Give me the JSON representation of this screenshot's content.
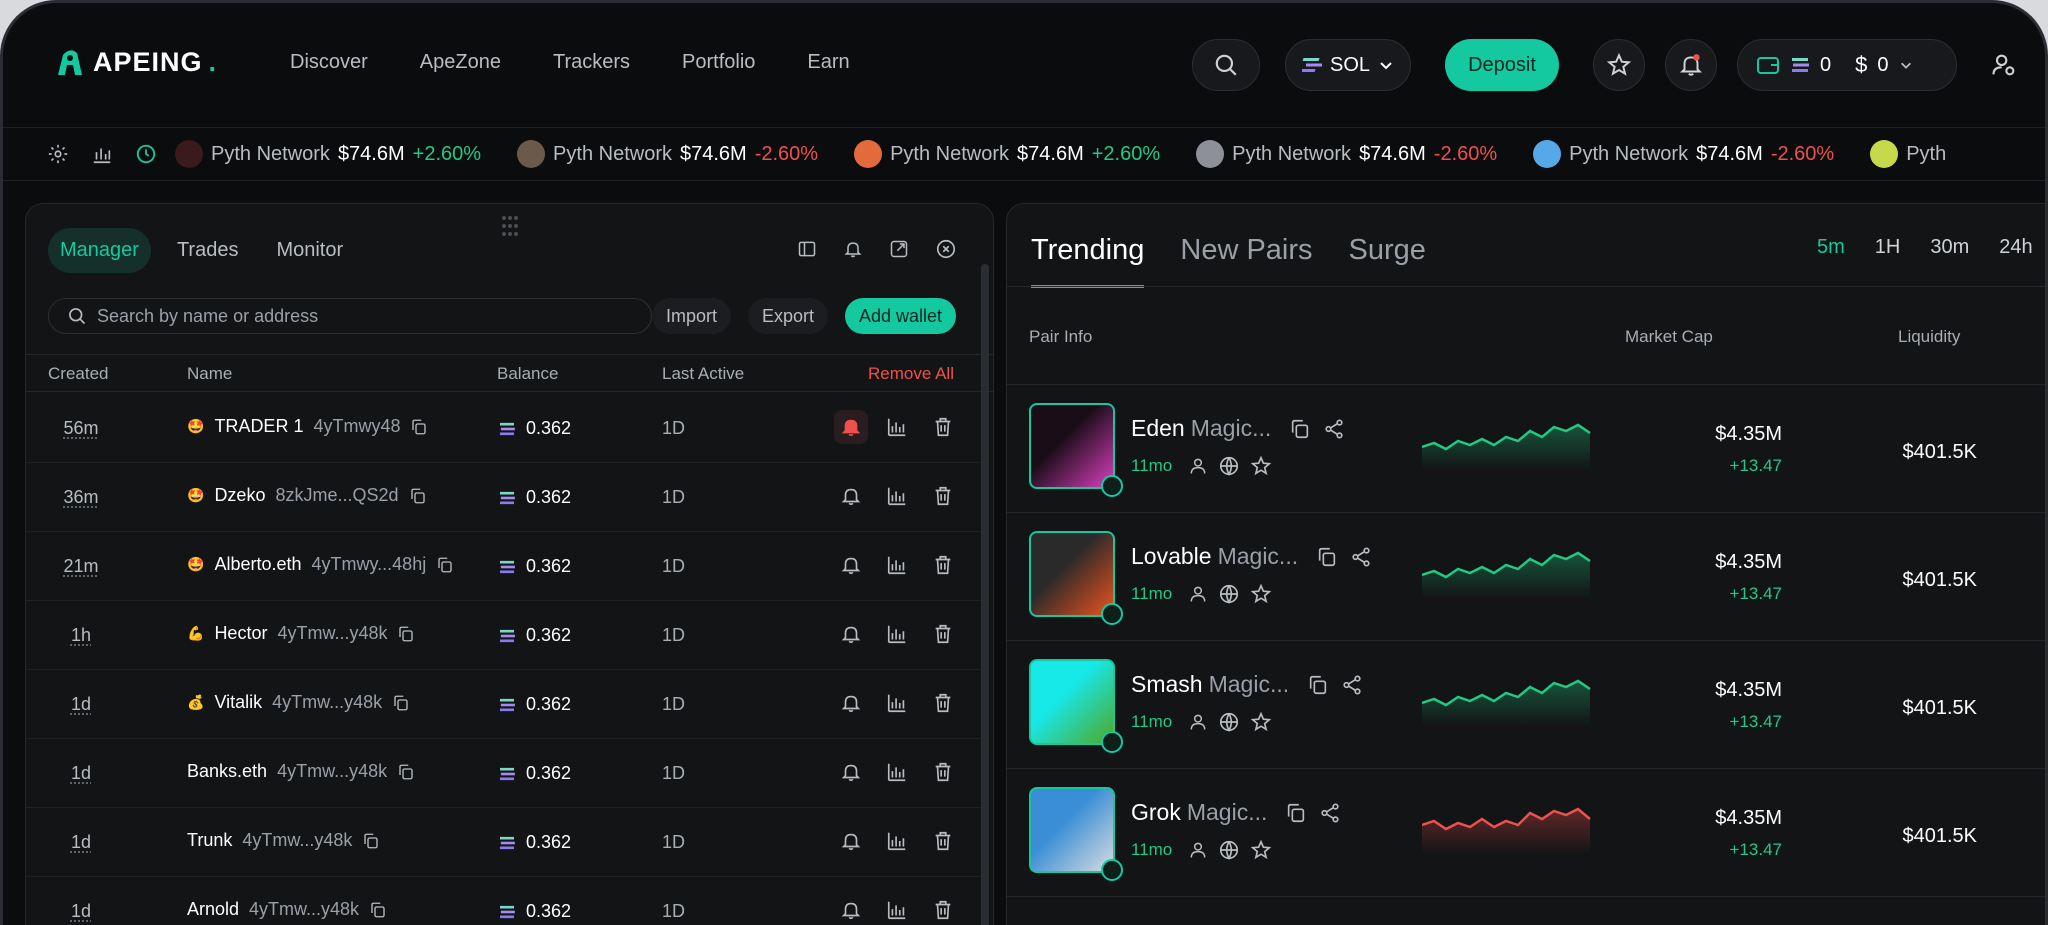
{
  "brand": {
    "name": "APEING",
    "dot": "."
  },
  "nav": [
    "Discover",
    "ApeZone",
    "Trackers",
    "Portfolio",
    "Earn"
  ],
  "header": {
    "chain": "SOL",
    "deposit": "Deposit",
    "sol_balance": "0",
    "usd_balance": "0"
  },
  "ticker": [
    {
      "name": "Pyth Network",
      "value": "$74.6M",
      "change": "+2.60%",
      "dir": "up",
      "color": "#3a1a1a"
    },
    {
      "name": "Pyth Network",
      "value": "$74.6M",
      "change": "-2.60%",
      "dir": "down",
      "color": "#6b5a4a"
    },
    {
      "name": "Pyth Network",
      "value": "$74.6M",
      "change": "+2.60%",
      "dir": "up",
      "color": "#e36a3a"
    },
    {
      "name": "Pyth Network",
      "value": "$74.6M",
      "change": "-2.60%",
      "dir": "down",
      "color": "#8d9096"
    },
    {
      "name": "Pyth Network",
      "value": "$74.6M",
      "change": "-2.60%",
      "dir": "down",
      "color": "#57a8e8"
    },
    {
      "name": "Pyth",
      "value": "",
      "change": "",
      "dir": "up",
      "color": "#c6d94a"
    }
  ],
  "manager": {
    "tabs": [
      "Manager",
      "Trades",
      "Monitor"
    ],
    "search_placeholder": "Search by name or address",
    "import": "Import",
    "export": "Export",
    "add_wallet": "Add wallet",
    "columns": {
      "created": "Created",
      "name": "Name",
      "balance": "Balance",
      "last_active": "Last Active",
      "remove_all": "Remove All"
    },
    "rows": [
      {
        "created": "56m",
        "emoji": "🤩",
        "name": "TRADER 1",
        "addr": "4yTmwy48",
        "balance": "0.362",
        "active": "1D",
        "bell": true
      },
      {
        "created": "36m",
        "emoji": "🤩",
        "name": "Dzeko",
        "addr": "8zkJme...QS2d",
        "balance": "0.362",
        "active": "1D",
        "bell": false
      },
      {
        "created": "21m",
        "emoji": "🤩",
        "name": "Alberto.eth",
        "addr": "4yTmwy...48hj",
        "balance": "0.362",
        "active": "1D",
        "bell": false
      },
      {
        "created": "1h",
        "emoji": "💪",
        "name": "Hector",
        "addr": "4yTmw...y48k",
        "balance": "0.362",
        "active": "1D",
        "bell": false
      },
      {
        "created": "1d",
        "emoji": "💰",
        "name": "Vitalik",
        "addr": "4yTmw...y48k",
        "balance": "0.362",
        "active": "1D",
        "bell": false
      },
      {
        "created": "1d",
        "emoji": "",
        "name": "Banks.eth",
        "addr": "4yTmw...y48k",
        "balance": "0.362",
        "active": "1D",
        "bell": false
      },
      {
        "created": "1d",
        "emoji": "",
        "name": "Trunk",
        "addr": "4yTmw...y48k",
        "balance": "0.362",
        "active": "1D",
        "bell": false
      },
      {
        "created": "1d",
        "emoji": "",
        "name": "Arnold",
        "addr": "4yTmw...y48k",
        "balance": "0.362",
        "active": "1D",
        "bell": false
      }
    ]
  },
  "pairs": {
    "tabs": [
      "Trending",
      "New Pairs",
      "Surge"
    ],
    "timeframes": [
      "5m",
      "1H",
      "30m",
      "24h"
    ],
    "columns": {
      "info": "Pair Info",
      "mcap": "Market Cap",
      "liquidity": "Liquidity"
    },
    "rows": [
      {
        "symbol": "Eden",
        "name": "Magic...",
        "age": "11mo",
        "mcap": "$4.35M",
        "change": "+13.47",
        "liquidity": "$401.5K",
        "trend": "up",
        "img": "#1a0d18",
        "img2": "#d83fbd"
      },
      {
        "symbol": "Lovable",
        "name": "Magic...",
        "age": "11mo",
        "mcap": "$4.35M",
        "change": "+13.47",
        "liquidity": "$401.5K",
        "trend": "up",
        "img": "#2a2a2a",
        "img2": "#e9531f"
      },
      {
        "symbol": "Smash",
        "name": "Magic...",
        "age": "11mo",
        "mcap": "$4.35M",
        "change": "+13.47",
        "liquidity": "$401.5K",
        "trend": "up",
        "img": "#17e8e8",
        "img2": "#4fa826"
      },
      {
        "symbol": "Grok",
        "name": "Magic...",
        "age": "11mo",
        "mcap": "$4.35M",
        "change": "+13.47",
        "liquidity": "$401.5K",
        "trend": "down",
        "img": "#3a8ed6",
        "img2": "#d8dbe0"
      }
    ]
  },
  "colors": {
    "accent": "#14c8a0",
    "up": "#22c983",
    "down": "#f0504d"
  }
}
